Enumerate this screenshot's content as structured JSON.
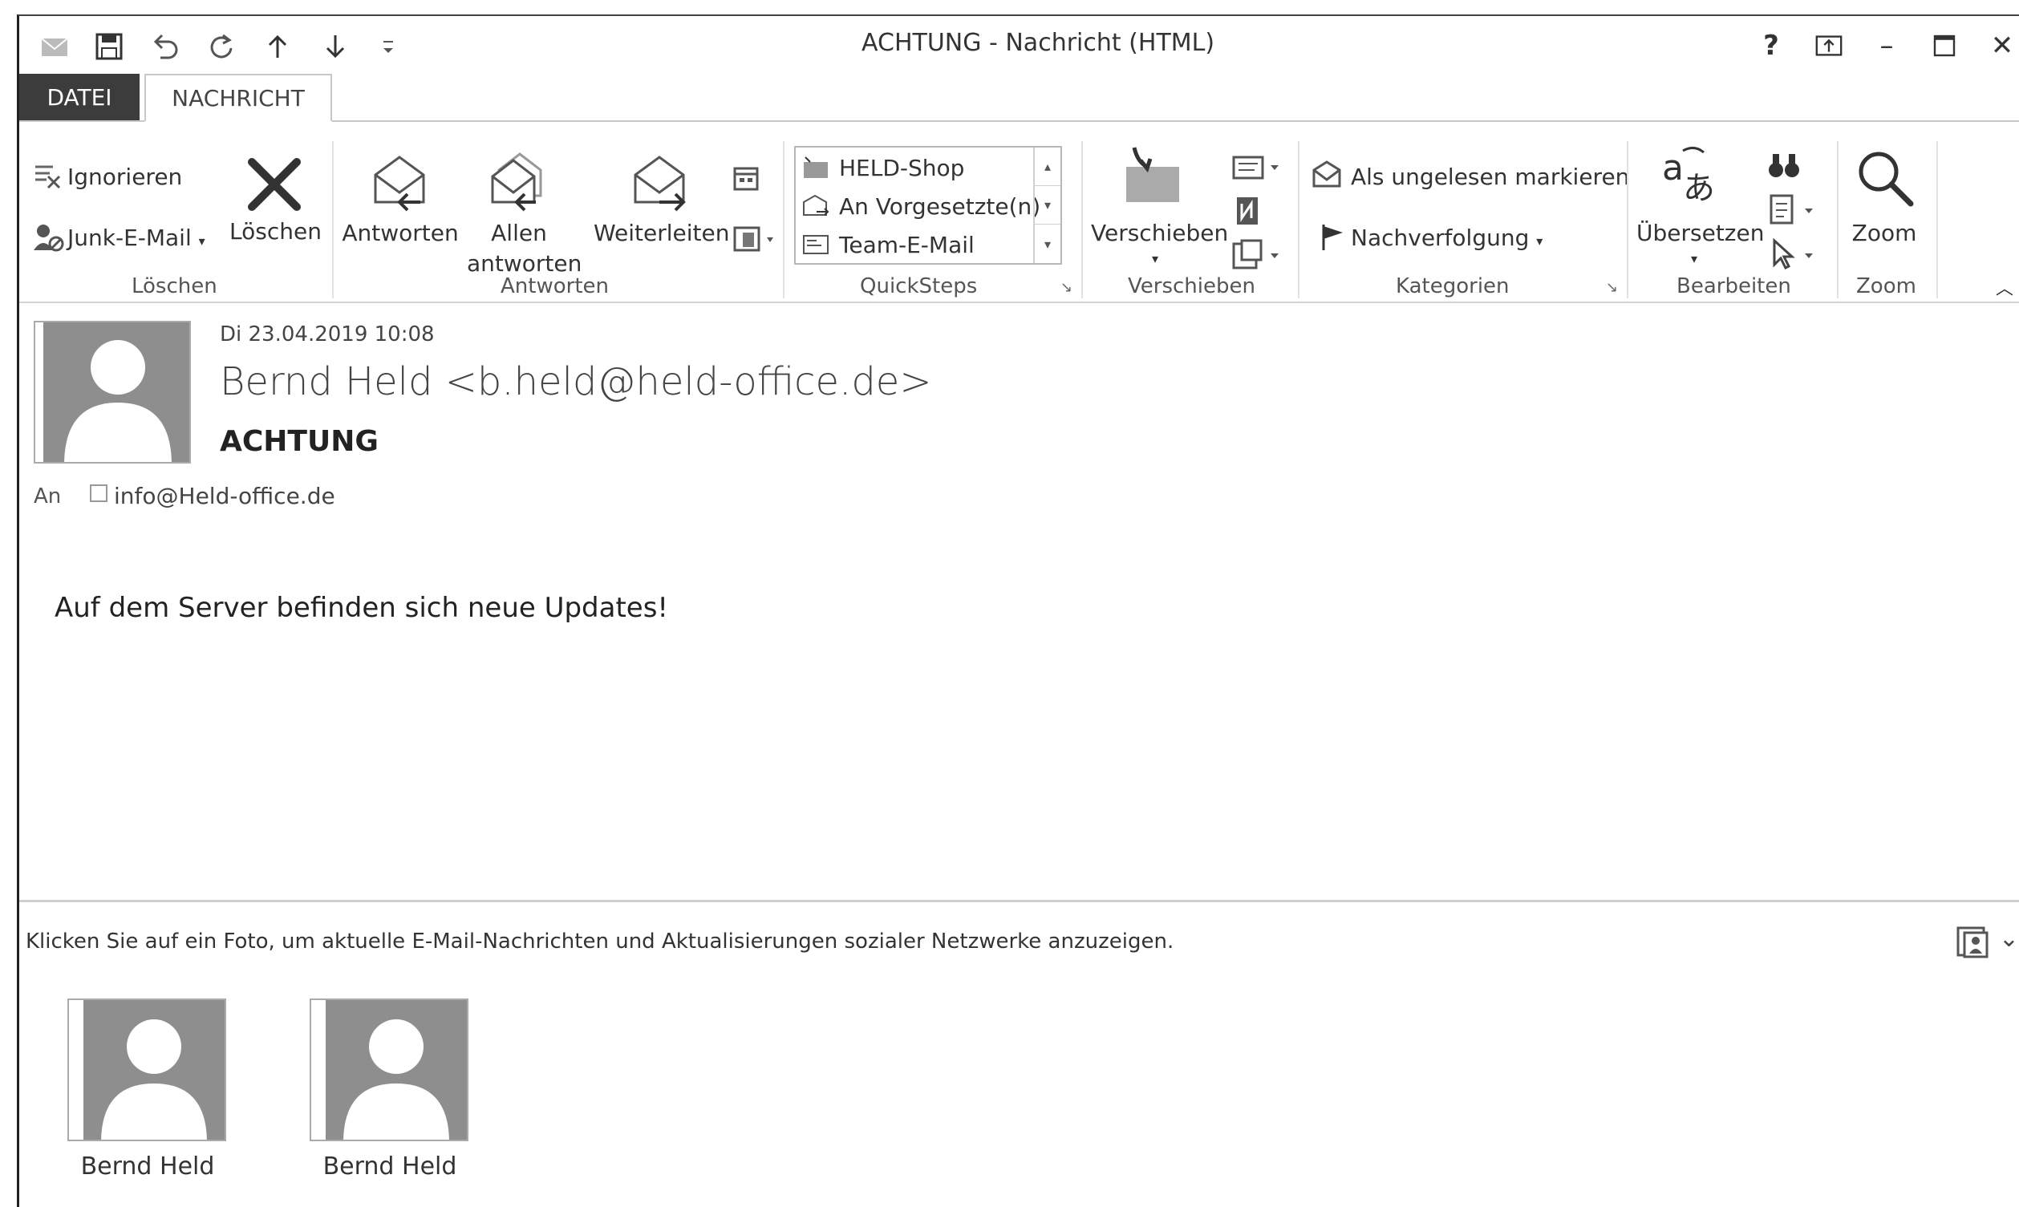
{
  "window": {
    "title": "ACHTUNG - Nachricht (HTML)",
    "controls": {
      "help": "?",
      "minimize": "–",
      "maximize": "☐",
      "close": "✕"
    }
  },
  "tabs": {
    "file": "DATEI",
    "message": "NACHRICHT"
  },
  "ribbon": {
    "loeschen": {
      "label": "Löschen",
      "ignore": "Ignorieren",
      "junk": "Junk-E-Mail",
      "delete": "Löschen"
    },
    "antworten": {
      "label": "Antworten",
      "reply": "Antworten",
      "reply_all_line1": "Allen",
      "reply_all_line2": "antworten",
      "forward": "Weiterleiten"
    },
    "quicksteps": {
      "label": "QuickSteps",
      "items": [
        "HELD-Shop",
        "An Vorgesetzte(n)",
        "Team-E-Mail"
      ]
    },
    "verschieben": {
      "label": "Verschieben",
      "move": "Verschieben"
    },
    "kategorien": {
      "label": "Kategorien",
      "mark_unread": "Als ungelesen markieren",
      "followup": "Nachverfolgung"
    },
    "bearbeiten": {
      "label": "Bearbeiten",
      "translate": "Übersetzen"
    },
    "zoom": {
      "label": "Zoom",
      "zoom": "Zoom"
    }
  },
  "message": {
    "date": "Di 23.04.2019 10:08",
    "sender": "Bernd Held <b.held@held-office.de>",
    "subject": "ACHTUNG",
    "to_label": "An",
    "to_address": "info@Held-office.de",
    "body": "Auf dem Server befinden sich neue Updates!"
  },
  "people_pane": {
    "info": "Klicken Sie auf ein Foto, um aktuelle E-Mail-Nachrichten und Aktualisierungen sozialer Netzwerke anzuzeigen.",
    "people": [
      {
        "name": "Bernd Held"
      },
      {
        "name": "Bernd Held"
      }
    ]
  },
  "colors": {
    "file_tab": "#3c3c3c",
    "avatar": "#8e8e8e",
    "window_border": "#222222"
  }
}
